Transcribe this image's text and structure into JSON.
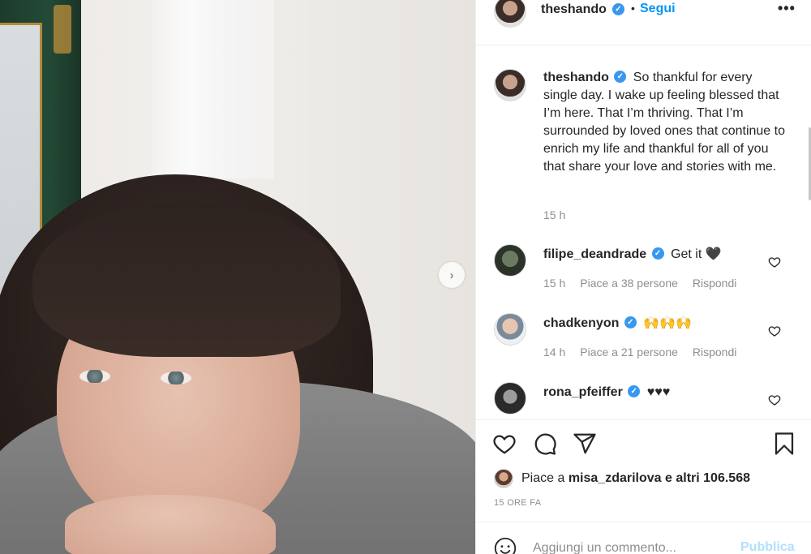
{
  "post": {
    "author": "theshando",
    "follow_label": "Segui",
    "header_dot": "•",
    "more_label": "•••",
    "caption": "So thankful for every single day. I wake up feeling blessed that I’m here. That I’m thriving. That I’m surrounded by loved ones that continue to enrich my life and thankful for all of you that share your love and stories with me.",
    "caption_time": "15 h",
    "next_arrow": "›"
  },
  "comments": [
    {
      "user": "filipe_deandrade",
      "text": "Get it 🖤",
      "time": "15 h",
      "likes": "Piace a 38 persone",
      "reply": "Rispondi"
    },
    {
      "user": "chadkenyon",
      "text": "🙌🙌🙌",
      "time": "14 h",
      "likes": "Piace a 21 persone",
      "reply": "Rispondi"
    },
    {
      "user": "rona_pfeiffer",
      "text": "♥♥♥",
      "time": "",
      "likes": "",
      "reply": ""
    }
  ],
  "actions": {
    "icons": [
      "heart-icon",
      "comment-icon",
      "share-icon",
      "bookmark-icon"
    ]
  },
  "likes": {
    "prefix": "Piace a",
    "user": "misa_zdarilova",
    "suffix": "e altri 106.568"
  },
  "time_ago": "15 ORE FA",
  "add_comment": {
    "placeholder": "Aggiungi un commento...",
    "post_label": "Pubblica"
  },
  "colors": {
    "link_blue": "#0095f6",
    "verified_blue": "#3897f0",
    "muted": "#8e8e8e",
    "post_disabled": "#b2dffc"
  }
}
